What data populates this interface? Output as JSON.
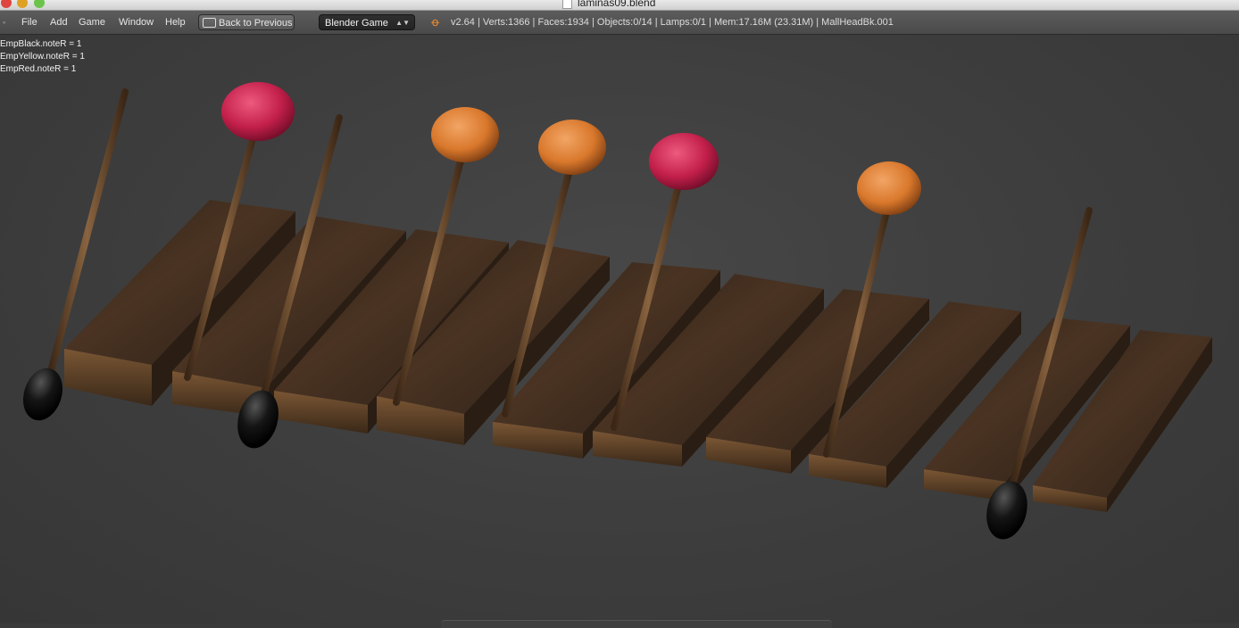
{
  "window": {
    "title": "laminas09.blend"
  },
  "menu": {
    "toggle_icon": "◦",
    "items": [
      "File",
      "Add",
      "Game",
      "Window",
      "Help"
    ]
  },
  "toolbar": {
    "back_label": "Back to Previous",
    "engine": "Blender Game",
    "engine_arrows": "▲▼",
    "blender_icon": "ꝋ",
    "stats": "v2.64 | Verts:1366 | Faces:1934 | Objects:0/14 | Lamps:0/1 | Mem:17.16M (23.31M) | MallHeadBk.001"
  },
  "viewport": {
    "properties": [
      "EmpBlack.noteR = 1",
      "EmpYellow.noteR = 1",
      "EmpRed.noteR = 1"
    ]
  },
  "colors": {
    "mallet_red": "#c21f4a",
    "mallet_orange": "#d9782c",
    "mallet_black": "#111111",
    "wood": "#3b2a1c"
  }
}
